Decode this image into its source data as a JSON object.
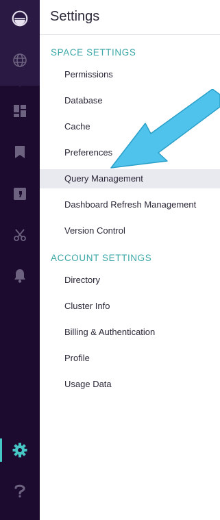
{
  "header": {
    "title": "Settings"
  },
  "sidebar": {
    "icons": [
      "logo-icon",
      "globe-icon",
      "dashboard-icon",
      "bookmark-icon",
      "query-icon",
      "scissors-icon",
      "bell-icon",
      "gear-icon",
      "help-icon"
    ],
    "active": "gear-icon"
  },
  "space_settings": {
    "heading": "SPACE SETTINGS",
    "items": [
      {
        "label": "Permissions"
      },
      {
        "label": "Database"
      },
      {
        "label": "Cache"
      },
      {
        "label": "Preferences"
      },
      {
        "label": "Query Management"
      },
      {
        "label": "Dashboard Refresh Management"
      },
      {
        "label": "Version Control"
      }
    ]
  },
  "account_settings": {
    "heading": "ACCOUNT SETTINGS",
    "items": [
      {
        "label": "Directory"
      },
      {
        "label": "Cluster Info"
      },
      {
        "label": "Billing & Authentication"
      },
      {
        "label": "Profile"
      },
      {
        "label": "Usage Data"
      }
    ]
  },
  "colors": {
    "sidebar": "#1c0b2e",
    "accent": "#46c6c4",
    "arrow": "#4fc3ec",
    "active_row": "#e9eaef"
  }
}
